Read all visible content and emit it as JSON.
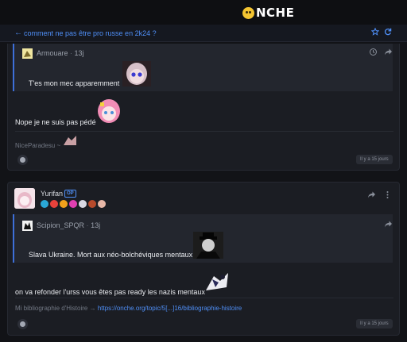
{
  "header": {
    "logo_text": "NCHE"
  },
  "topic": {
    "back_icon": "back-arrow-icon",
    "title": "comment ne pas être pro russe en 2k24 ?"
  },
  "post1": {
    "quote": {
      "author": "Armouare",
      "separator": "·",
      "age": "13j",
      "text": "T'es mon mec apparemment"
    },
    "text": "Nope je ne suis pas pédé",
    "signature": "NiceParadesu ~",
    "time": "Il y a 15 jours"
  },
  "post2": {
    "author": "Yurifan",
    "op_label": "OP",
    "badge_colors": [
      "#2aa7d6",
      "#e8423b",
      "#f2a21b",
      "#e03fb0",
      "#d9d9e3",
      "#b74a2b",
      "#e7b7a7"
    ],
    "quote": {
      "author": "Scipion_SPQR",
      "separator": "·",
      "age": "13j",
      "text": "Slava Ukraine. Mort aux néo-bolchéviques mentaux !"
    },
    "text": "on va refonder l'urss vous êtes pas ready les nazis mentaux",
    "signature_prefix": "Mi bibliographie d'Histoire →",
    "signature_link": "https://onche.org/topic/5[...]16/bibliographie-histoire",
    "time": "Il y a 15 jours"
  },
  "colors": {
    "accent": "#4f8ff7",
    "background": "#121317",
    "card": "#1b1d23"
  }
}
